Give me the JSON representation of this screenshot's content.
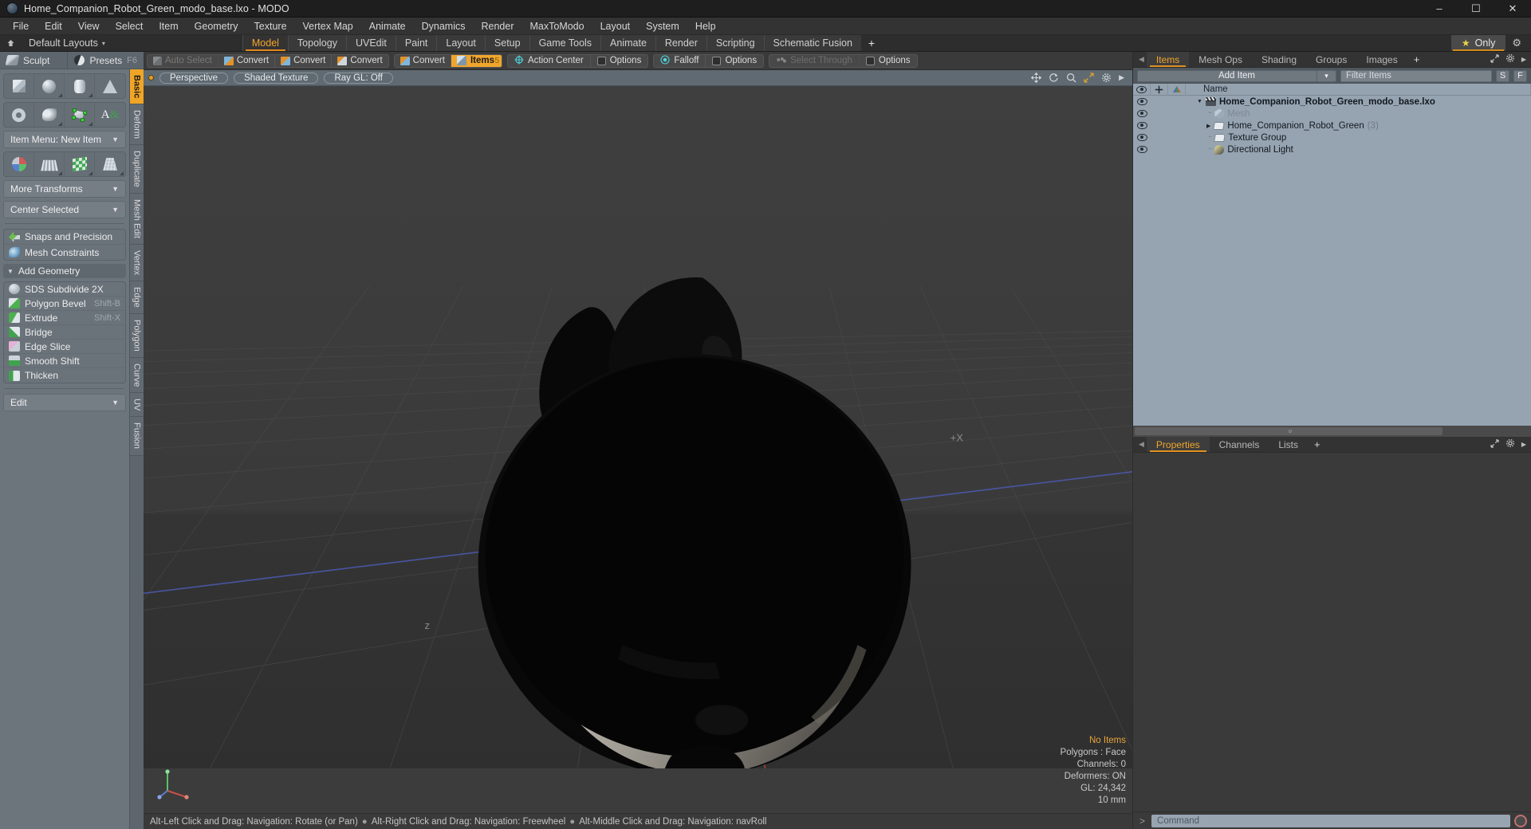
{
  "window": {
    "title": "Home_Companion_Robot_Green_modo_base.lxo - MODO",
    "app_icon": "modo-logo-icon",
    "minimize": "–",
    "maximize": "☐",
    "close": "✕"
  },
  "menubar": {
    "items": [
      "File",
      "Edit",
      "View",
      "Select",
      "Item",
      "Geometry",
      "Texture",
      "Vertex Map",
      "Animate",
      "Dynamics",
      "Render",
      "MaxToModo",
      "Layout",
      "System",
      "Help"
    ]
  },
  "layoutbar": {
    "default_layouts_label": "Default Layouts",
    "caret": "▾",
    "tabs": [
      {
        "label": "Model",
        "active": true
      },
      {
        "label": "Topology",
        "active": false
      },
      {
        "label": "UVEdit",
        "active": false
      },
      {
        "label": "Paint",
        "active": false
      },
      {
        "label": "Layout",
        "active": false
      },
      {
        "label": "Setup",
        "active": false
      },
      {
        "label": "Game Tools",
        "active": false
      },
      {
        "label": "Animate",
        "active": false
      },
      {
        "label": "Render",
        "active": false
      },
      {
        "label": "Scripting",
        "active": false
      },
      {
        "label": "Schematic Fusion",
        "active": false
      }
    ],
    "add_tab": "+",
    "only_button": "Only",
    "star_glyph": "★",
    "gear_glyph": "⚙"
  },
  "modebar": {
    "items": [
      {
        "label": "Auto Select",
        "icon": "cube-icon",
        "state": "disabled",
        "group": 0
      },
      {
        "label": "Convert",
        "icon": "convert-vertex-icon",
        "state": "normal",
        "group": 0
      },
      {
        "label": "Convert",
        "icon": "convert-edge-icon",
        "state": "normal",
        "group": 0
      },
      {
        "label": "Convert",
        "icon": "convert-polygon-icon",
        "state": "normal",
        "group": 0
      },
      {
        "label": "Convert",
        "icon": "convert-material-icon",
        "state": "normal",
        "group": 1
      },
      {
        "label": "Items",
        "icon": "items-cube-icon",
        "state": "active",
        "badge": "5",
        "group": 1
      },
      {
        "label": "Action Center",
        "icon": "action-center-icon",
        "state": "normal",
        "group": 2
      },
      {
        "label": "Options",
        "icon": "options-square-icon",
        "state": "normal",
        "group": 2
      },
      {
        "label": "Falloff",
        "icon": "falloff-icon",
        "state": "normal",
        "group": 3
      },
      {
        "label": "Options",
        "icon": "options-square-icon",
        "state": "normal",
        "group": 3
      },
      {
        "label": "Select Through",
        "icon": "select-through-icon",
        "state": "disabled",
        "group": 4
      },
      {
        "label": "Options",
        "icon": "options-square-icon",
        "state": "normal",
        "group": 4
      }
    ]
  },
  "left_panel": {
    "top_tabs": [
      {
        "label": "Sculpt",
        "icon": "sculpt-icon",
        "shortcut": ""
      },
      {
        "label": "Presets",
        "icon": "presets-sphere-icon",
        "shortcut": "F6"
      }
    ],
    "primitives_row1": [
      {
        "name": "cube-primitive",
        "icon": "cube-icon"
      },
      {
        "name": "sphere-primitive",
        "icon": "sphere-icon"
      },
      {
        "name": "cylinder-primitive",
        "icon": "cylinder-icon"
      },
      {
        "name": "cone-primitive",
        "icon": "cone-icon"
      }
    ],
    "primitives_row2": [
      {
        "name": "torus-primitive",
        "icon": "torus-icon"
      },
      {
        "name": "curve-primitive",
        "icon": "curve-icon"
      },
      {
        "name": "polygon-primitive",
        "icon": "polygon-points-icon"
      },
      {
        "name": "text-primitive",
        "icon": "text-icon"
      }
    ],
    "item_menu_label": "Item Menu: New Item",
    "transform_tiles": [
      {
        "name": "transform-tool",
        "icon": "axis-handles-icon"
      },
      {
        "name": "bend-tool",
        "icon": "grid-deform-icon"
      },
      {
        "name": "uv-tool",
        "icon": "checker-icon"
      },
      {
        "name": "taper-tool",
        "icon": "cage-icon"
      }
    ],
    "more_transforms_label": "More Transforms",
    "center_selected_label": "Center Selected",
    "snaps_label": "Snaps and Precision",
    "mesh_constraints_label": "Mesh Constraints",
    "add_geometry_label": "Add Geometry",
    "geometry_tools": [
      {
        "label": "SDS Subdivide 2X",
        "shortcut": "",
        "icon": "sds-subdivide-icon"
      },
      {
        "label": "Polygon Bevel",
        "shortcut": "Shift-B",
        "icon": "polygon-bevel-icon"
      },
      {
        "label": "Extrude",
        "shortcut": "Shift-X",
        "icon": "extrude-icon"
      },
      {
        "label": "Bridge",
        "shortcut": "",
        "icon": "bridge-icon"
      },
      {
        "label": "Edge Slice",
        "shortcut": "",
        "icon": "edge-slice-icon"
      },
      {
        "label": "Smooth Shift",
        "shortcut": "",
        "icon": "smooth-shift-icon"
      },
      {
        "label": "Thicken",
        "shortcut": "",
        "icon": "thicken-icon"
      }
    ],
    "edit_dropdown_label": "Edit",
    "vertical_tabs": [
      {
        "label": "Basic",
        "active": true
      },
      {
        "label": "Deform",
        "active": false
      },
      {
        "label": "Duplicate",
        "active": false
      },
      {
        "label": "Mesh Edit",
        "active": false
      },
      {
        "label": "Vertex",
        "active": false
      },
      {
        "label": "Edge",
        "active": false
      },
      {
        "label": "Polygon",
        "active": false
      },
      {
        "label": "Curve",
        "active": false
      },
      {
        "label": "UV",
        "active": false
      },
      {
        "label": "Fusion",
        "active": false
      }
    ]
  },
  "viewport": {
    "header_pills": [
      "Perspective",
      "Shaded Texture",
      "Ray GL: Off"
    ],
    "header_icons": [
      "pan-icon",
      "rotate-icon",
      "zoom-icon",
      "fit-icon",
      "gear-icon",
      "chevron-right-icon"
    ],
    "axis_label_x": "+X",
    "axis_label_z": "z",
    "stats": {
      "selection": "No Items",
      "polygons": "Polygons : Face",
      "channels": "Channels: 0",
      "deformers": "Deformers: ON",
      "gl": "GL: 24,342",
      "grid": "10 mm"
    },
    "gizmo_labels": [
      "x",
      "y",
      "z"
    ]
  },
  "statusbar": {
    "hints": [
      "Alt-Left Click and Drag: Navigation: Rotate (or Pan)",
      "Alt-Right Click and Drag: Navigation: Freewheel",
      "Alt-Middle Click and Drag: Navigation: navRoll"
    ],
    "separator": "●"
  },
  "right_panel": {
    "tabs": [
      {
        "label": "Items",
        "active": true
      },
      {
        "label": "Mesh Ops",
        "active": false
      },
      {
        "label": "Shading",
        "active": false
      },
      {
        "label": "Groups",
        "active": false
      },
      {
        "label": "Images",
        "active": false
      }
    ],
    "add_tab": "+",
    "tools": [
      "expand-icon",
      "gear-icon",
      "chevron-right-icon"
    ],
    "add_item_label": "Add Item",
    "add_item_caret": "▾",
    "filter_placeholder": "Filter Items",
    "s_button": "S",
    "f_button": "F",
    "tree_columns": {
      "eye": "visibility-column",
      "lock": "lock-column",
      "shade": "shading-column",
      "name": "Name"
    },
    "tree_rows": [
      {
        "name": "Home_Companion_Robot_Green_modo_base.lxo",
        "icon": "scene-clapper-icon",
        "depth": 0,
        "expander": "open",
        "bold": true,
        "dim": false,
        "count": ""
      },
      {
        "name": "Mesh",
        "icon": "mesh-icon",
        "depth": 1,
        "expander": "leaf",
        "bold": false,
        "dim": true,
        "count": ""
      },
      {
        "name": "Home_Companion_Robot_Green",
        "icon": "folder-icon",
        "depth": 1,
        "expander": "closed",
        "bold": false,
        "dim": false,
        "count": "(3)"
      },
      {
        "name": "Texture Group",
        "icon": "folder-icon",
        "depth": 1,
        "expander": "leaf",
        "bold": false,
        "dim": false,
        "count": ""
      },
      {
        "name": "Directional Light",
        "icon": "light-icon",
        "depth": 1,
        "expander": "leaf",
        "bold": false,
        "dim": false,
        "count": ""
      }
    ],
    "properties_tabs": [
      {
        "label": "Properties",
        "active": true
      },
      {
        "label": "Channels",
        "active": false
      },
      {
        "label": "Lists",
        "active": false
      }
    ],
    "properties_add_tab": "+"
  },
  "command_bar": {
    "prompt": ">",
    "placeholder": "Command",
    "record_icon": "record-icon"
  },
  "colors": {
    "accent_orange": "#f0a62c",
    "panel_grey": "#6c747c",
    "tree_blue": "#96a4b1",
    "dark_chrome": "#333333",
    "viewport_bg": "#3c3c3c",
    "axis_x": "#b04a42",
    "axis_z": "#4a5fb0"
  }
}
